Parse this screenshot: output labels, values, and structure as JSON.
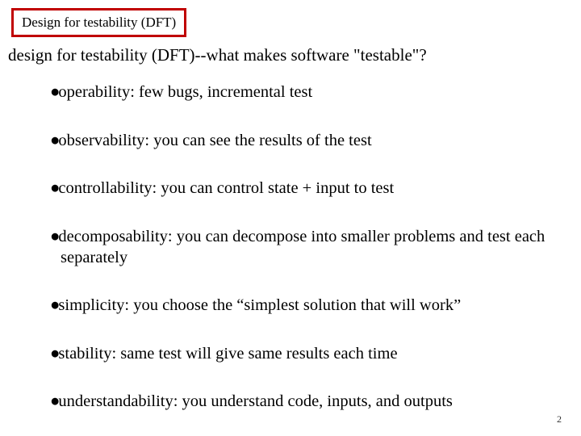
{
  "title_box": "Design for testability (DFT)",
  "subtitle": "design for testability (DFT)--what makes software \"testable\"?",
  "bullets": [
    "operability:  few bugs, incremental test",
    "observability:  you can see the results of the test",
    "controllability:  you can control state + input to test",
    "decomposability:  you can decompose into smaller problems and test each separately",
    "simplicity:  you choose the “simplest solution that will work”",
    "stability:  same test will give same results each time",
    "understandability:  you understand code, inputs, and outputs"
  ],
  "page_number": "2"
}
